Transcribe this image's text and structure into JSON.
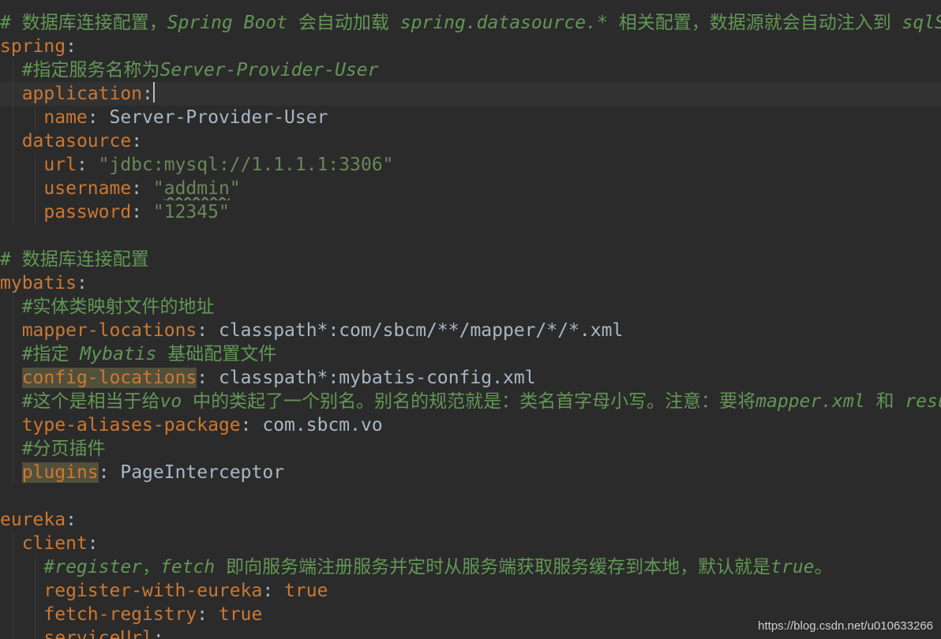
{
  "editor": {
    "lines": [
      {
        "c": [
          [
            "# 数据库连接配置，",
            "comment"
          ],
          [
            "Spring Boot",
            "comment-it"
          ],
          [
            " 会自动加载 ",
            "comment"
          ],
          [
            "spring.datasource.*",
            "comment-it"
          ],
          [
            " 相关配置，数据源就会自动注入到 ",
            "comment"
          ],
          [
            "sqlSessionFactory",
            "comment-it"
          ]
        ]
      },
      {
        "c": [
          [
            "spring",
            "key"
          ],
          [
            ":",
            "punct"
          ]
        ]
      },
      {
        "c": [
          [
            "  ",
            "punct"
          ],
          [
            "#指定服务名称为",
            "comment"
          ],
          [
            "Server-Provider-User",
            "comment-it"
          ]
        ]
      },
      {
        "current": true,
        "c": [
          [
            "  ",
            "punct"
          ],
          [
            "application",
            "key"
          ],
          [
            ":",
            "punct"
          ],
          [
            "",
            "caret"
          ]
        ]
      },
      {
        "c": [
          [
            "    ",
            "punct"
          ],
          [
            "name",
            "key"
          ],
          [
            ": ",
            "punct"
          ],
          [
            "Server-Provider-User",
            "val"
          ]
        ]
      },
      {
        "c": [
          [
            "  ",
            "punct"
          ],
          [
            "datasource",
            "key"
          ],
          [
            ":",
            "punct"
          ]
        ]
      },
      {
        "c": [
          [
            "    ",
            "punct"
          ],
          [
            "url",
            "key"
          ],
          [
            ": ",
            "punct"
          ],
          [
            "\"jdbc:mysql://1.1.1.1:3306\"",
            "str"
          ]
        ]
      },
      {
        "c": [
          [
            "    ",
            "punct"
          ],
          [
            "username",
            "key"
          ],
          [
            ": ",
            "punct"
          ],
          [
            "\"",
            "str"
          ],
          [
            "addmin",
            "str-squiggle"
          ],
          [
            "\"",
            "str"
          ]
        ]
      },
      {
        "c": [
          [
            "    ",
            "punct"
          ],
          [
            "password",
            "key"
          ],
          [
            ": ",
            "punct"
          ],
          [
            "\"12345\"",
            "str"
          ]
        ]
      },
      {
        "c": []
      },
      {
        "c": [
          [
            "# 数据库连接配置",
            "comment"
          ]
        ]
      },
      {
        "c": [
          [
            "mybatis",
            "key"
          ],
          [
            ":",
            "punct"
          ]
        ]
      },
      {
        "c": [
          [
            "  ",
            "punct"
          ],
          [
            "#实体类映射文件的地址",
            "comment"
          ]
        ]
      },
      {
        "c": [
          [
            "  ",
            "punct"
          ],
          [
            "mapper-locations",
            "key"
          ],
          [
            ": ",
            "punct"
          ],
          [
            "classpath*:com/sbcm/**/mapper/*/*.xml",
            "val"
          ]
        ]
      },
      {
        "c": [
          [
            "  ",
            "punct"
          ],
          [
            "#指定 ",
            "comment"
          ],
          [
            "Mybatis",
            "comment-it"
          ],
          [
            " 基础配置文件",
            "comment"
          ]
        ]
      },
      {
        "c": [
          [
            "  ",
            "punct"
          ],
          [
            "config-locations",
            "key-warn"
          ],
          [
            ": ",
            "punct"
          ],
          [
            "classpath*:mybatis-config.xml",
            "val"
          ]
        ]
      },
      {
        "c": [
          [
            "  ",
            "punct"
          ],
          [
            "#这个是相当于给",
            "comment"
          ],
          [
            "vo",
            "comment-it"
          ],
          [
            " 中的类起了一个别名。别名的规范就是：类名首字母小写。注意：要将",
            "comment"
          ],
          [
            "mapper.xml",
            "comment-it"
          ],
          [
            " 和 ",
            "comment"
          ],
          [
            "resultType",
            "comment-it"
          ]
        ]
      },
      {
        "c": [
          [
            "  ",
            "punct"
          ],
          [
            "type-aliases-package",
            "key"
          ],
          [
            ": ",
            "punct"
          ],
          [
            "com.sbcm.vo",
            "val"
          ]
        ]
      },
      {
        "c": [
          [
            "  ",
            "punct"
          ],
          [
            "#分页插件",
            "comment"
          ]
        ]
      },
      {
        "c": [
          [
            "  ",
            "punct"
          ],
          [
            "plugins",
            "key-warn"
          ],
          [
            ": ",
            "punct"
          ],
          [
            "PageInterceptor",
            "val"
          ]
        ]
      },
      {
        "c": []
      },
      {
        "c": [
          [
            "eureka",
            "key"
          ],
          [
            ":",
            "punct"
          ]
        ]
      },
      {
        "c": [
          [
            "  ",
            "punct"
          ],
          [
            "client",
            "key"
          ],
          [
            ":",
            "punct"
          ]
        ]
      },
      {
        "c": [
          [
            "    ",
            "punct"
          ],
          [
            "#register",
            "comment-it"
          ],
          [
            "，",
            "comment"
          ],
          [
            "fetch",
            "comment-it"
          ],
          [
            " 即向服务端注册服务并定时从服务端获取服务缓存到本地，默认就是",
            "comment"
          ],
          [
            "true",
            "comment-it"
          ],
          [
            "。",
            "comment"
          ]
        ]
      },
      {
        "c": [
          [
            "    ",
            "punct"
          ],
          [
            "register-with-eureka",
            "key"
          ],
          [
            ": ",
            "punct"
          ],
          [
            "true",
            "bool"
          ]
        ]
      },
      {
        "c": [
          [
            "    ",
            "punct"
          ],
          [
            "fetch-registry",
            "key"
          ],
          [
            ": ",
            "punct"
          ],
          [
            "true",
            "bool"
          ]
        ]
      },
      {
        "c": [
          [
            "    ",
            "punct"
          ],
          [
            "serviceUrl",
            "key"
          ],
          [
            ":",
            "punct"
          ]
        ]
      }
    ]
  },
  "watermark": {
    "text": "https://blog.csdn.net/u010633266"
  }
}
